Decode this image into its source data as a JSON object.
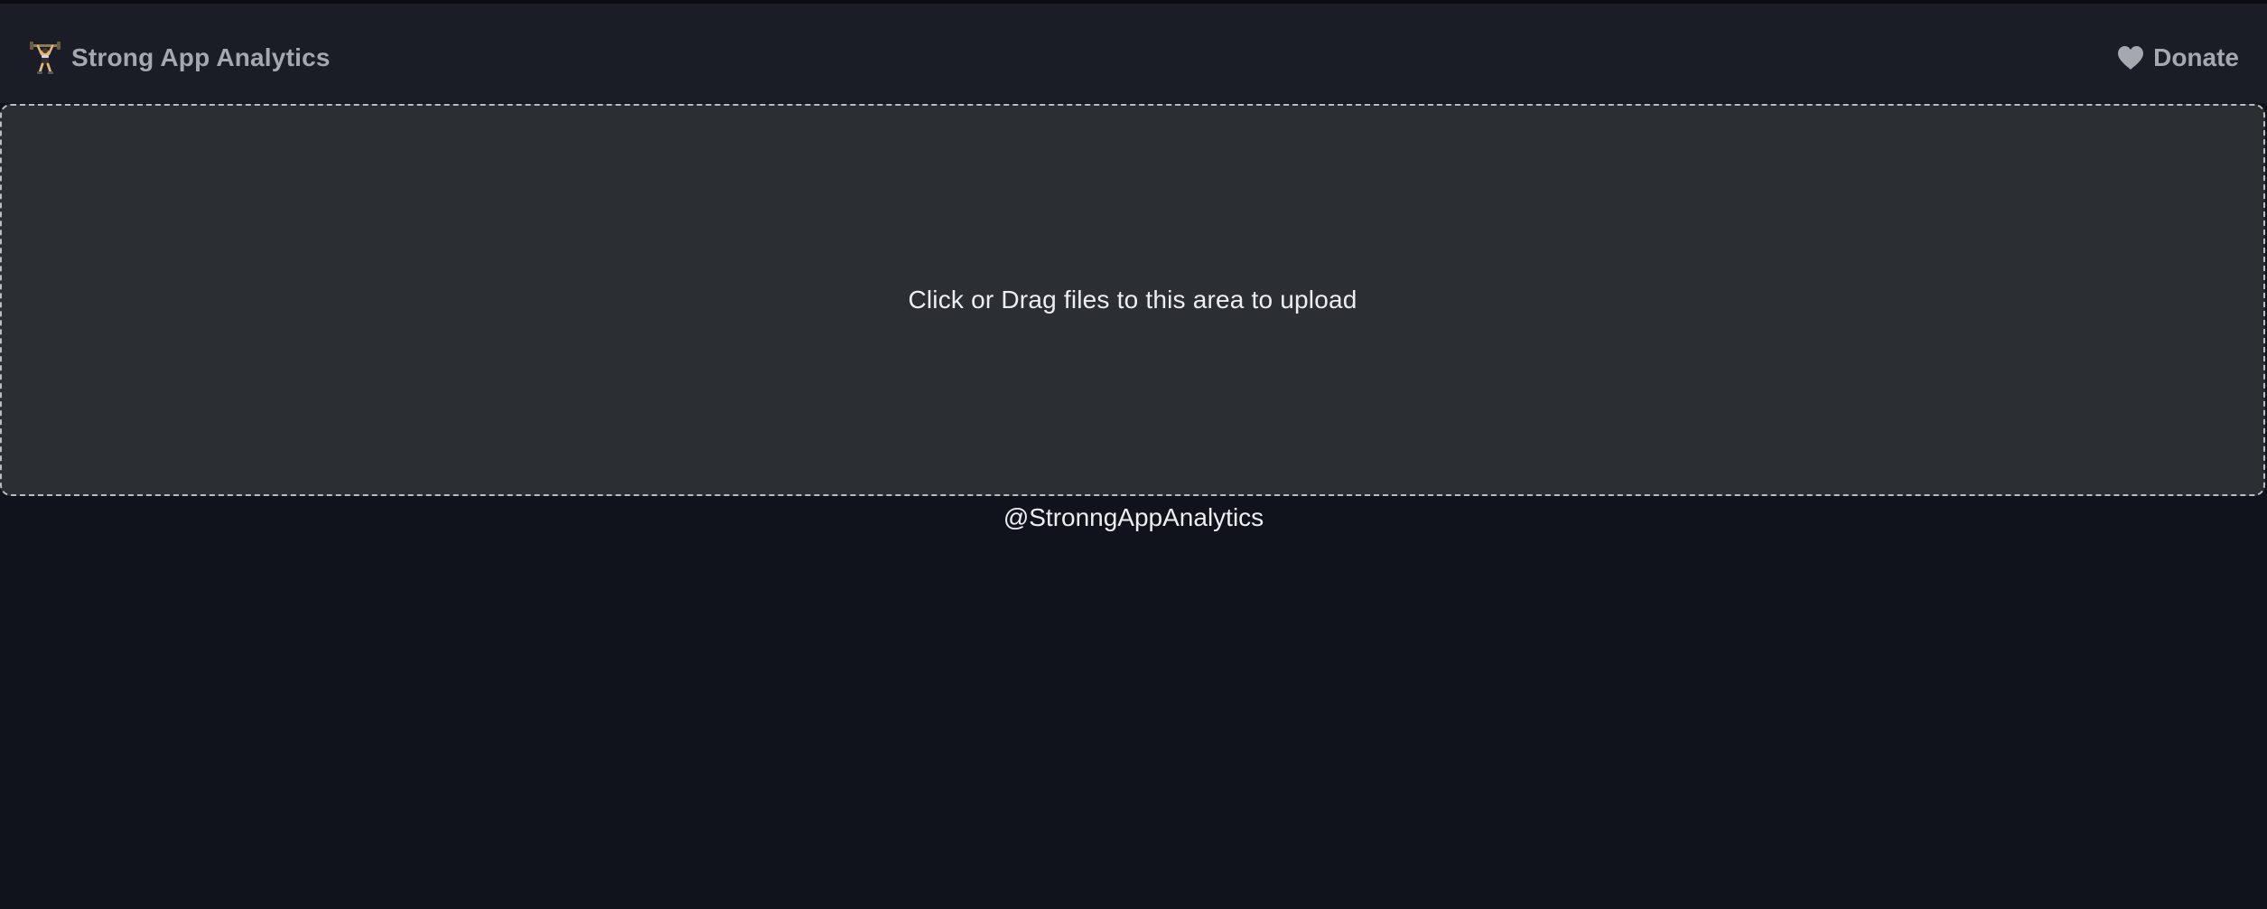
{
  "header": {
    "brand_title": "Strong App Analytics",
    "brand_icon": "weightlifter-icon",
    "donate_label": "Donate",
    "donate_icon": "heart-icon"
  },
  "upload": {
    "prompt": "Click or Drag files to this area to upload"
  },
  "footer": {
    "handle": "@StronngAppAnalytics"
  },
  "colors": {
    "page_background": "#10131b",
    "navbar_background": "#1a1d25",
    "upload_background": "#2b2e33",
    "upload_border": "#b9bcc2",
    "nav_text": "#a5a8af",
    "body_text": "#eceef1"
  }
}
